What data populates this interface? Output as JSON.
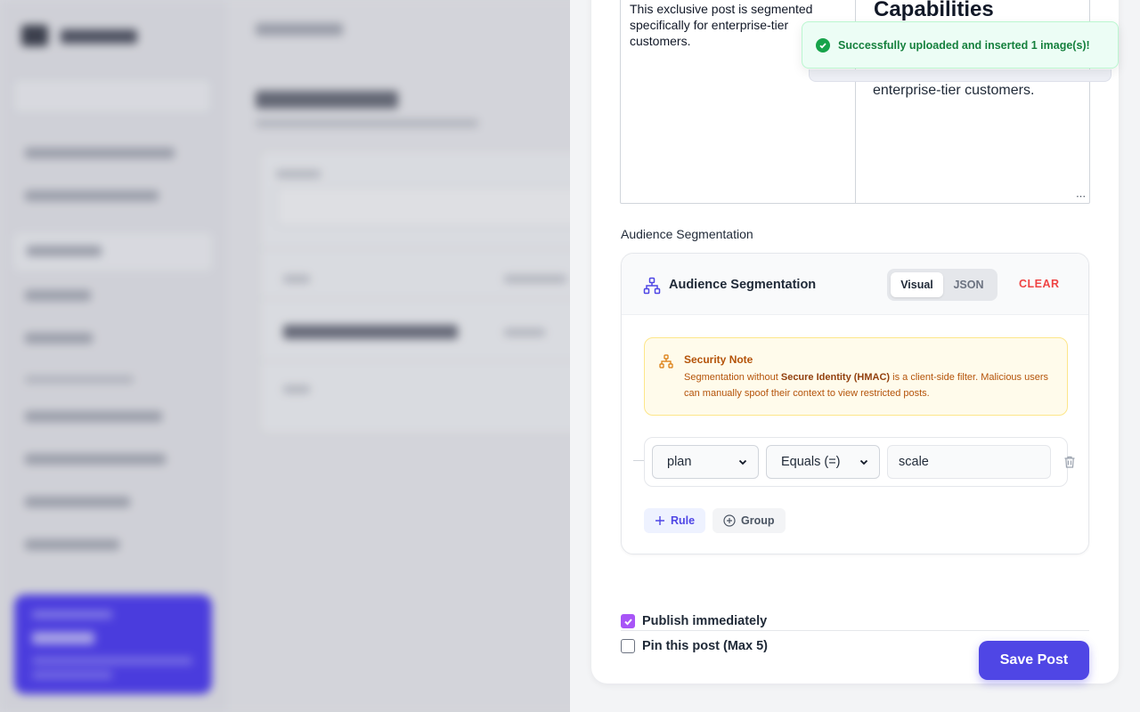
{
  "background_app": {
    "description_hidden": true
  },
  "editor": {
    "source_text": "This exclusive post is segmented specifically for enterprise-tier customers.",
    "preview_heading": "Capabilities",
    "preview_body": "enterprise-tier customers.",
    "resize_glyph": "⋰"
  },
  "segmentation": {
    "section_label": "Audience Segmentation",
    "title": "Audience Segmentation",
    "toggle": {
      "visual": "Visual",
      "json": "JSON",
      "active": "Visual"
    },
    "clear_label": "CLEAR",
    "note": {
      "title": "Security Note",
      "text_before": "Segmentation without ",
      "text_bold": "Secure Identity (HMAC)",
      "text_after": " is a client-side filter. Malicious users can manually spoof their context to view restricted posts."
    },
    "rule": {
      "field": "plan",
      "operator": "Equals (=)",
      "value": "scale"
    },
    "add_rule_label": "Rule",
    "add_group_label": "Group"
  },
  "footer": {
    "publish_label": "Publish immediately",
    "publish_checked": true,
    "pin_label": "Pin this post (Max 5)",
    "pin_checked": false,
    "save_label": "Save Post"
  },
  "toast": {
    "message": "Successfully uploaded and inserted 1 image(s)!",
    "status": "success"
  },
  "colors": {
    "accent": "#4f46e5",
    "danger": "#ef4444",
    "warning": "#b45309",
    "success": "#16a34a",
    "checkbox": "#a855f7"
  }
}
